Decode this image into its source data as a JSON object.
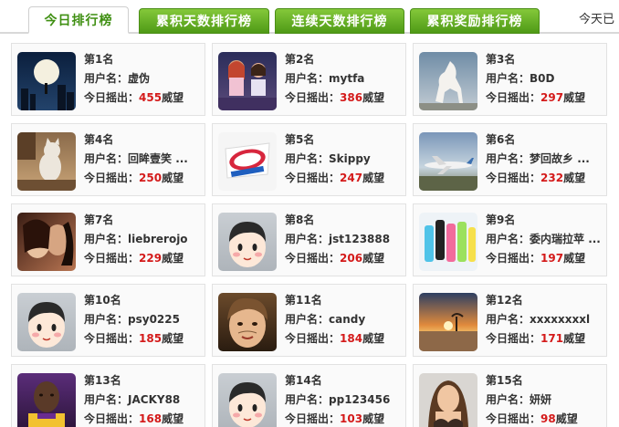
{
  "tabs": {
    "today": "今日排行榜",
    "total_days": "累积天数排行榜",
    "consecutive_days": "连续天数排行榜",
    "total_rewards": "累积奖励排行榜",
    "more": "今天已"
  },
  "labels": {
    "username": "用户名：",
    "today_score": "今日摇出：",
    "unit": "威望"
  },
  "colors": {
    "accent_green": "#4f9a16",
    "score_red": "#d41a1a"
  },
  "ranking": [
    {
      "rank": "第1名",
      "username": "虚伪",
      "score": "455",
      "avatar": "night-moon-city-avatar"
    },
    {
      "rank": "第2名",
      "username": "mytfa",
      "score": "386",
      "avatar": "two-girls-sitting-avatar"
    },
    {
      "rank": "第3名",
      "username": "B0D",
      "score": "297",
      "avatar": "white-horse-avatar"
    },
    {
      "rank": "第4名",
      "username": "回眸壹笑 ...",
      "score": "250",
      "avatar": "cat-room-avatar"
    },
    {
      "rank": "第5名",
      "username": "Skippy",
      "score": "247",
      "avatar": "skippy-logo-avatar"
    },
    {
      "rank": "第6名",
      "username": "梦回故乡 ...",
      "score": "232",
      "avatar": "airplane-avatar"
    },
    {
      "rank": "第7名",
      "username": "liebrerojo",
      "score": "229",
      "avatar": "kissing-couple-avatar"
    },
    {
      "rank": "第8名",
      "username": "jst123888",
      "score": "206",
      "avatar": "default-cartoon-avatar"
    },
    {
      "rank": "第9名",
      "username": "委内瑞拉苹 ...",
      "score": "197",
      "avatar": "colorful-phones-avatar"
    },
    {
      "rank": "第10名",
      "username": "psy0225",
      "score": "185",
      "avatar": "default-cartoon-avatar"
    },
    {
      "rank": "第11名",
      "username": "candy",
      "score": "184",
      "avatar": "child-face-avatar"
    },
    {
      "rank": "第12名",
      "username": "xxxxxxxxl",
      "score": "171",
      "avatar": "sunset-beach-avatar"
    },
    {
      "rank": "第13名",
      "username": "JACKY88",
      "score": "168",
      "avatar": "basketball-player-avatar"
    },
    {
      "rank": "第14名",
      "username": "pp123456",
      "score": "103",
      "avatar": "default-cartoon-avatar"
    },
    {
      "rank": "第15名",
      "username": "妍妍",
      "score": "98",
      "avatar": "woman-portrait-avatar"
    }
  ]
}
